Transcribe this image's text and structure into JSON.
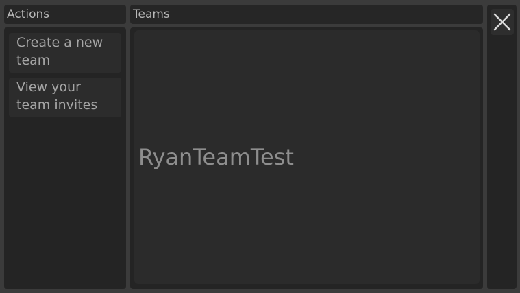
{
  "actions": {
    "header": "Actions",
    "items": [
      {
        "label": "Create a new team"
      },
      {
        "label": "View your team invites"
      }
    ]
  },
  "teams": {
    "header": "Teams",
    "list": [
      {
        "name": "RyanTeamTest"
      }
    ]
  },
  "window": {
    "close_icon": "close-icon"
  },
  "colors": {
    "background": "#3b3b3b",
    "panel": "#242424",
    "text": "#b8b8b8",
    "team_text": "#8e8e8e"
  }
}
